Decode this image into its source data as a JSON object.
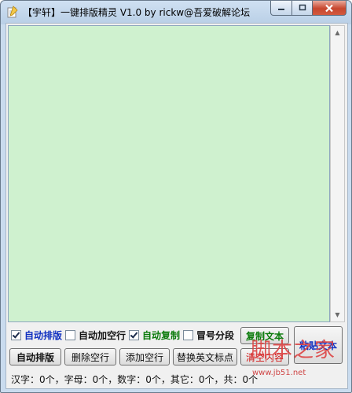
{
  "window": {
    "title": "【宇轩】一键排版精灵 V1.0 by rickw@吾爱破解论坛"
  },
  "checkboxes": [
    {
      "label": "自动排版",
      "checked": true,
      "color": "#1030c0"
    },
    {
      "label": "自动加空行",
      "checked": false,
      "color": "#000000"
    },
    {
      "label": "自动复制",
      "checked": true,
      "color": "#0a7a0a"
    },
    {
      "label": "冒号分段",
      "checked": false,
      "color": "#000000"
    }
  ],
  "buttons": {
    "copy_text": "复制文本",
    "paste_text": "粘贴文本",
    "auto_format": "自动排版",
    "delete_blank": "删除空行",
    "add_blank": "添加空行",
    "replace_punct": "替换英文标点",
    "clear": "清空内容"
  },
  "status": "汉字：0个，字母：0个，数字：0个，其它：0个，共：0个",
  "watermark": {
    "text": "脚本之家",
    "url": "www.jb51.net"
  },
  "colors": {
    "editor_bg": "#cff1cf",
    "copy_text_color": "#0a7a0a",
    "paste_text_color": "#1030c0",
    "clear_color": "#d01010"
  }
}
